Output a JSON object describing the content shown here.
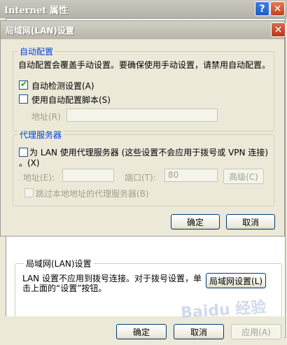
{
  "outer": {
    "title": "Internet 属性",
    "help_label": "?",
    "close_label": "✕",
    "lan_group": {
      "legend": "局域网(LAN)设置",
      "description": "LAN 设置不应用到拨号连接。对于拨号设置，单击上面的“设置”按钮。",
      "lan_settings_button": "局域网设置(L)"
    },
    "buttons": {
      "ok": "确定",
      "cancel": "取消",
      "apply": "应用(A)"
    }
  },
  "dialog": {
    "title": "局域网(LAN)设置",
    "close_label": "✕",
    "auto_config": {
      "legend": "自动配置",
      "description": "自动配置会覆盖手动设置。要确保使用手动设置，请禁用自动配置。",
      "auto_detect_label": "自动检测设置(A)",
      "auto_detect_checked": true,
      "use_script_label": "使用自动配置脚本(S)",
      "use_script_checked": false,
      "address_label": "地址(R)",
      "address_value": ""
    },
    "proxy": {
      "legend": "代理服务器",
      "use_proxy_label": "为 LAN 使用代理服务器 (这些设置不会应用于拨号或 VPN 连接)(X)",
      "use_proxy_label_line1": "为 LAN 使用代理服务器 (这些设置不会应用于拨号或 VPN 连接)",
      "use_proxy_label_line2": "。(X)",
      "use_proxy_checked": false,
      "address_label": "地址(E):",
      "address_value": "",
      "port_label": "端口(T):",
      "port_value": "80",
      "advanced_label": "高级(C)",
      "bypass_local_label": "跳过本地地址的代理服务器(B)",
      "bypass_local_checked": false
    },
    "buttons": {
      "ok": "确定",
      "cancel": "取消"
    }
  },
  "watermark": "Baidu 经验"
}
